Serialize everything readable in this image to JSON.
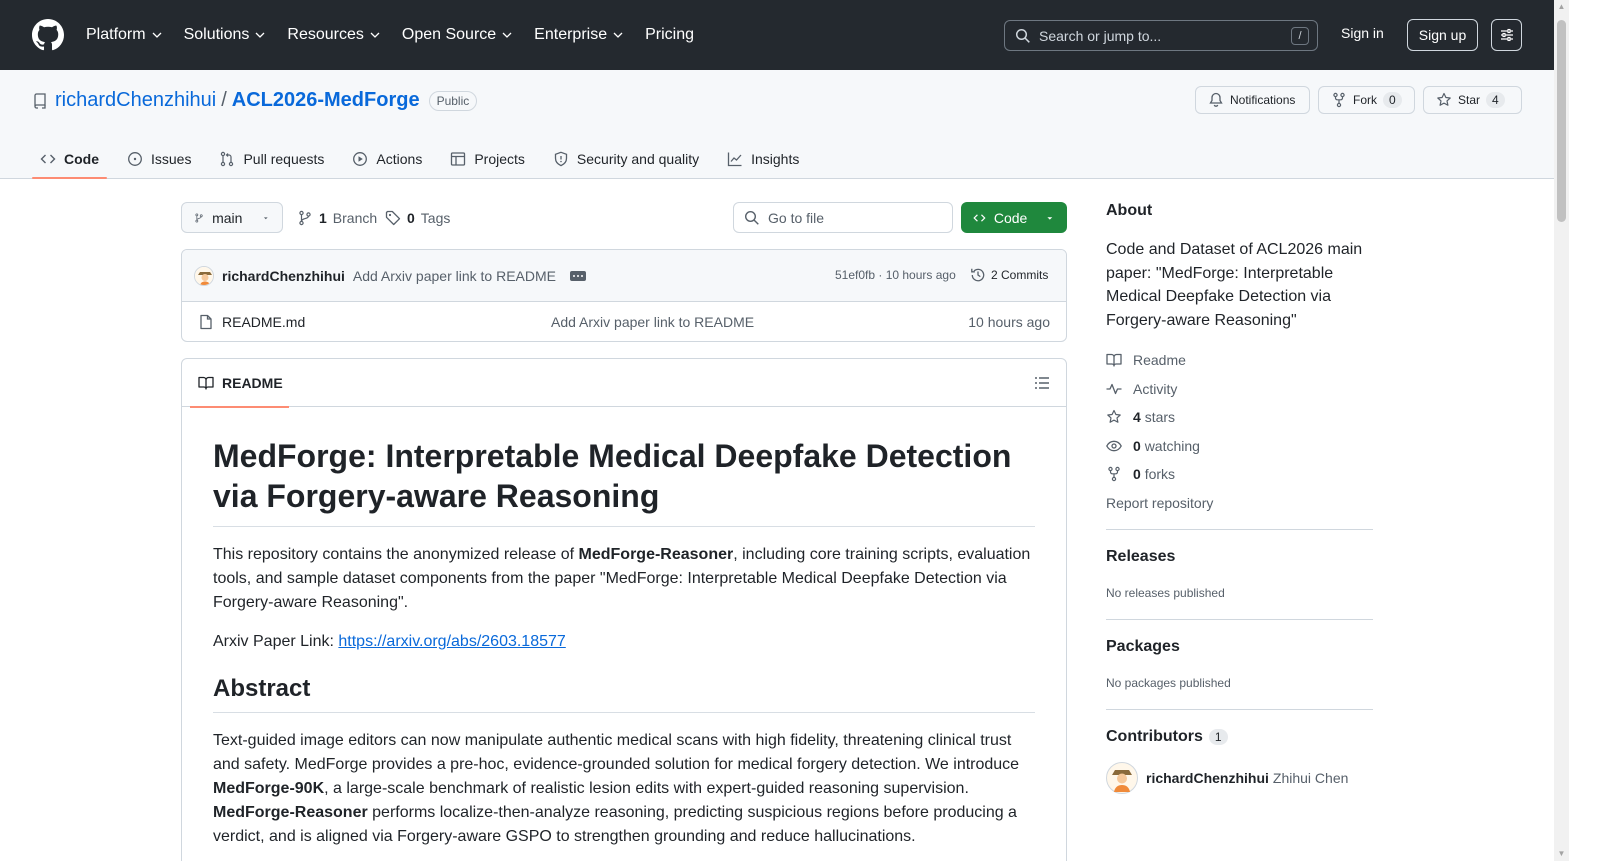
{
  "topnav": {
    "items": [
      "Platform",
      "Solutions",
      "Resources",
      "Open Source",
      "Enterprise",
      "Pricing"
    ],
    "search_placeholder": "Search or jump to...",
    "search_shortcut": "/",
    "signin": "Sign in",
    "signup": "Sign up"
  },
  "repo": {
    "owner": "richardChenzhihui",
    "separator": "/",
    "name": "ACL2026-MedForge",
    "visibility": "Public",
    "notifications_label": "Notifications",
    "fork_label": "Fork",
    "fork_count": "0",
    "star_label": "Star",
    "star_count": "4"
  },
  "tabs": [
    "Code",
    "Issues",
    "Pull requests",
    "Actions",
    "Projects",
    "Security and quality",
    "Insights"
  ],
  "toolbar": {
    "branch": "main",
    "branch_count": "1",
    "branch_label": "Branch",
    "tag_count": "0",
    "tag_label": "Tags",
    "goto_file": "Go to file",
    "code_button": "Code"
  },
  "commit": {
    "author": "richardChenzhihui",
    "message": "Add Arxiv paper link to README",
    "hash_time": "51ef0fb · 10 hours ago",
    "commits": "2 Commits"
  },
  "files": [
    {
      "name": "README.md",
      "message": "Add Arxiv paper link to README",
      "time": "10 hours ago"
    }
  ],
  "readme": {
    "tab_label": "README",
    "title": "MedForge: Interpretable Medical Deepfake Detection via Forgery-aware Reasoning",
    "intro_pre": "This repository contains the anonymized release of ",
    "intro_bold": "MedForge-Reasoner",
    "intro_post": ", including core training scripts, evaluation tools, and sample dataset components from the paper \"MedForge: Interpretable Medical Deepfake Detection via Forgery-aware Reasoning\".",
    "arxiv_label": "Arxiv Paper Link: ",
    "arxiv_url": "https://arxiv.org/abs/2603.18577",
    "abstract_heading": "Abstract",
    "abstract_1": "Text-guided image editors can now manipulate authentic medical scans with high fidelity, threatening clinical trust and safety. MedForge provides a pre-hoc, evidence-grounded solution for medical forgery detection. We introduce ",
    "abstract_bold1": "MedForge-90K",
    "abstract_2": ", a large-scale benchmark of realistic lesion edits with expert-guided reasoning supervision. ",
    "abstract_bold2": "MedForge-Reasoner",
    "abstract_3": " performs localize-then-analyze reasoning, predicting suspicious regions before producing a verdict, and is aligned via Forgery-aware GSPO to strengthen grounding and reduce hallucinations."
  },
  "about": {
    "heading": "About",
    "description": "Code and Dataset of ACL2026 main paper: \"MedForge: Interpretable Medical Deepfake Detection via Forgery-aware Reasoning\"",
    "readme": "Readme",
    "activity": "Activity",
    "stars_count": "4",
    "stars_label": "stars",
    "watching_count": "0",
    "watching_label": "watching",
    "forks_count": "0",
    "forks_label": "forks",
    "report": "Report repository"
  },
  "releases": {
    "heading": "Releases",
    "empty": "No releases published"
  },
  "packages": {
    "heading": "Packages",
    "empty": "No packages published"
  },
  "contributors": {
    "heading": "Contributors",
    "count": "1",
    "items": [
      {
        "username": "richardChenzhihui",
        "fullname": "Zhihui Chen"
      }
    ]
  },
  "colors": {
    "header_bg": "#24292f",
    "link": "#0969da",
    "code_button": "#1f883d",
    "active_tab_underline": "#fd8c73"
  }
}
